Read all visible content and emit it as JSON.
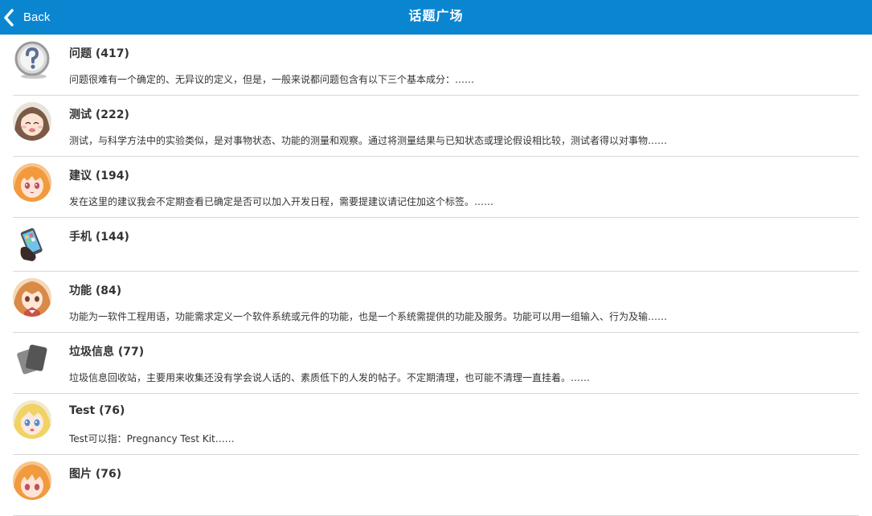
{
  "header": {
    "back_label": "Back",
    "title": "话题广场",
    "background_color": "#0a86d1"
  },
  "topics": [
    {
      "title": "问题 (417)",
      "desc": "问题很难有一个确定的、无异议的定义，但是，一般来说都问题包含有以下三个基本成分：……",
      "icon": "question-mark-icon"
    },
    {
      "title": "测试 (222)",
      "desc": "测试，与科学方法中的实验类似，是对事物状态、功能的测量和观察。通过将测量结果与已知状态或理论假设相比较，测试者得以对事物……",
      "icon": "anime-girl-avatar"
    },
    {
      "title": "建议 (194)",
      "desc": "发在这里的建议我会不定期查看已确定是否可以加入开发日程，需要提建议请记住加这个标签。……",
      "icon": "anime-girl-avatar"
    },
    {
      "title": "手机 (144)",
      "desc": "",
      "icon": "phone-in-hand-icon"
    },
    {
      "title": "功能 (84)",
      "desc": "功能为一软件工程用语，功能需求定义一个软件系统或元件的功能，也是一个系统需提供的功能及服务。功能可以用一组输入、行为及输……",
      "icon": "anime-girl-avatar"
    },
    {
      "title": "垃圾信息 (77)",
      "desc": "垃圾信息回收站，主要用来收集还没有学会说人话的、素质低下的人发的帖子。不定期清理，也可能不清理一直挂着。……",
      "icon": "cards-icon"
    },
    {
      "title": "Test (76)",
      "desc": "Test可以指：Pregnancy Test Kit……",
      "icon": "anime-girl-avatar"
    },
    {
      "title": "图片 (76)",
      "desc": "",
      "icon": "anime-girl-avatar"
    }
  ]
}
